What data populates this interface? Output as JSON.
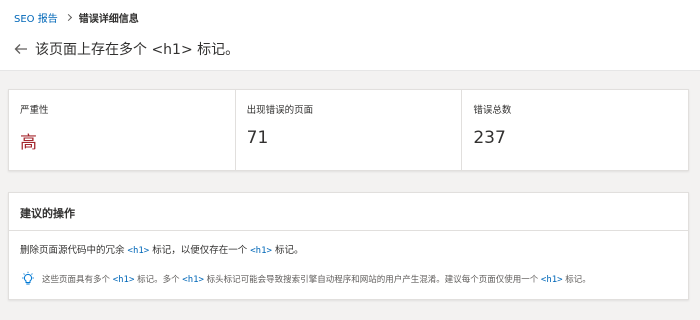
{
  "breadcrumb": {
    "root": "SEO 报告",
    "current": "错误详细信息"
  },
  "title": {
    "pre": "该页面上存在多个 ",
    "tag": "<h1>",
    "post": " 标记。"
  },
  "metrics": [
    {
      "label": "严重性",
      "value": "高"
    },
    {
      "label": "出现错误的页面",
      "value": "71"
    },
    {
      "label": "错误总数",
      "value": "237"
    }
  ],
  "actions": {
    "heading": "建议的操作",
    "text": {
      "p1": "删除页面源代码中的冗余 ",
      "code1": "<h1>",
      "p2": " 标记，以便仅存在一个 ",
      "code2": "<h1>",
      "p3": " 标记。"
    },
    "tip": {
      "p1": "这些页面具有多个 ",
      "code1": "<h1>",
      "p2": " 标记。多个 ",
      "code2": "<h1>",
      "p3": " 标头标记可能会导致搜索引擎自动程序和网站的用户产生混淆。建议每个页面仅使用一个 ",
      "code3": "<h1>",
      "p4": " 标记。"
    }
  },
  "colors": {
    "link": "#0067b8",
    "severity_high": "#a4262c",
    "tip_icon": "#0078d4"
  },
  "icons": {
    "back": "arrow-left-icon",
    "breadcrumb_separator": "chevron-right-icon",
    "tip": "lightbulb-icon"
  }
}
